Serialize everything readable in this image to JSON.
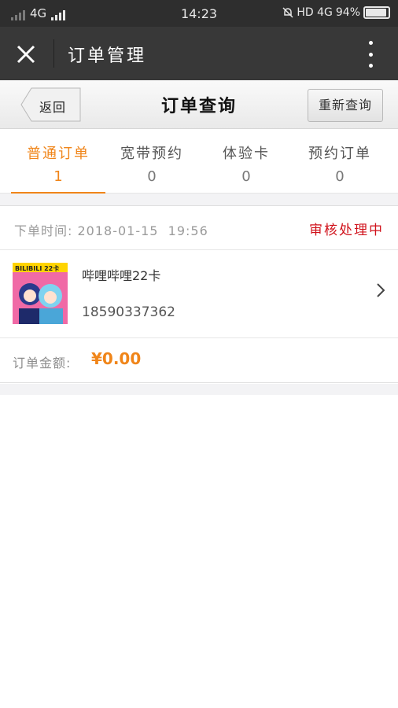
{
  "status_bar": {
    "network_left": "4G",
    "time": "14:23",
    "network_right": "HD 4G",
    "battery": "94%",
    "battery_level": 0.94
  },
  "nav": {
    "title": "订单管理"
  },
  "subheader": {
    "back_label": "返回",
    "title": "订单查询",
    "requery_label": "重新查询"
  },
  "tabs": [
    {
      "label": "普通订单",
      "count": "1",
      "active": true
    },
    {
      "label": "宽带预约",
      "count": "0",
      "active": false
    },
    {
      "label": "体验卡",
      "count": "0",
      "active": false
    },
    {
      "label": "预约订单",
      "count": "0",
      "active": false
    }
  ],
  "order": {
    "time_label": "下单时间:",
    "time_value": "2018-01-15  19:56",
    "status": "审核处理中",
    "product_name": "哔哩哔哩22卡",
    "phone": "18590337362",
    "thumb_text": "BILIBILI 22卡",
    "amount_label": "订单金额:",
    "amount_value": "¥0.00"
  },
  "colors": {
    "accent": "#f08519",
    "status_red": "#d0121b",
    "nav_bg": "#383838"
  }
}
